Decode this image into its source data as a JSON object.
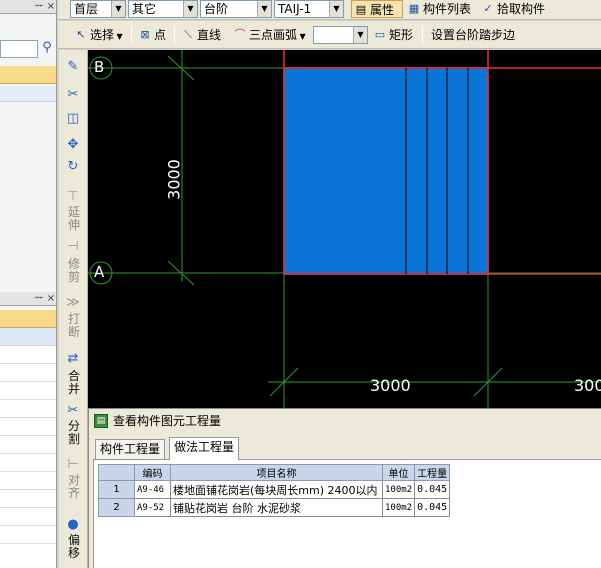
{
  "left_panel": {
    "top_caption": "ᅲ ×",
    "mid_caption": "ᅲ ×"
  },
  "toolbar1": {
    "floor": "首层",
    "category": "其它",
    "component_type": "台阶",
    "component_name": "TAIJ-1",
    "properties": "属性",
    "component_list": "构件列表",
    "pick_component": "拾取构件"
  },
  "toolbar2": {
    "select": "选择",
    "point": "点",
    "line": "直线",
    "three_point_arc": "三点画弧",
    "rectangle": "矩形",
    "set_step_edge": "设置台阶踏步边"
  },
  "vtoolbar": {
    "extend": [
      "延",
      "伸"
    ],
    "trim": [
      "修",
      "剪"
    ],
    "break": [
      "打",
      "断"
    ],
    "merge": [
      "合",
      "并"
    ],
    "split": [
      "分",
      "割"
    ],
    "align": [
      "对",
      "齐"
    ],
    "offset": [
      "偏",
      "移"
    ]
  },
  "canvas": {
    "axis_b": "B",
    "axis_a": "A",
    "dim_vertical": "3000",
    "dim_horizontal": "3000",
    "dim_horizontal_2": "300"
  },
  "dialog": {
    "title": "查看构件图元工程量",
    "tabs": [
      "构件工程量",
      "做法工程量"
    ],
    "columns": [
      "编码",
      "项目名称",
      "单位",
      "工程量"
    ],
    "rows": [
      {
        "no": "1",
        "code": "A9-46",
        "name": "楼地面铺花岗岩(每块周长mm) 2400以内",
        "unit": "100m2",
        "qty": "0.045"
      },
      {
        "no": "2",
        "code": "A9-52",
        "name": "铺贴花岗岩 台阶 水泥砂浆",
        "unit": "100m2",
        "qty": "0.045"
      }
    ]
  },
  "colors": {
    "canvas_bg": "#000000",
    "grid_line": "#2e9a2e",
    "step_fill": "#0a74d8",
    "selection_red": "#e8302e"
  }
}
